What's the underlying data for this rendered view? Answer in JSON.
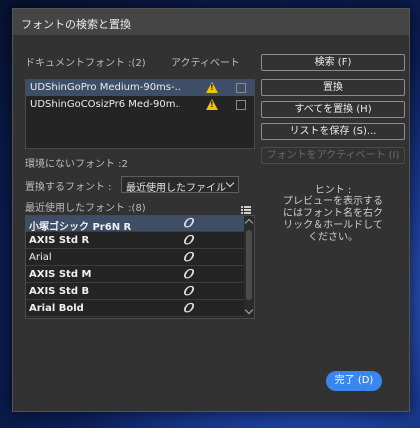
{
  "dialog": {
    "title": "フォントの検索と置換",
    "document_fonts_label": "ドキュメントフォント :(2)",
    "active_label": "アクティベート",
    "document_fonts": [
      {
        "name": "UDShinGoPro Medium-90ms-...",
        "missing": true,
        "checked": false
      },
      {
        "name": "UDShinGoCOsizPr6 Med-90m...",
        "missing": true,
        "checked": false
      }
    ],
    "missing_fonts_label": "環境にないフォント :2",
    "replace_with_label": "置換するフォント :",
    "replace_with_value": "最近使用したファイル",
    "recent_fonts_label": "最近使用したフォント :(8)",
    "recent_fonts": [
      {
        "name": "小塚ゴシック Pr6N R",
        "type_icon": "𝑂",
        "selected": true
      },
      {
        "name": "AXIS Std R",
        "type_icon": "𝑂",
        "selected": false
      },
      {
        "name": "Arial",
        "type_icon": "𝑂",
        "selected": false,
        "light": true
      },
      {
        "name": "AXIS Std M",
        "type_icon": "𝑂",
        "selected": false
      },
      {
        "name": "AXIS Std B",
        "type_icon": "𝑂",
        "selected": false
      },
      {
        "name": "Arial Bold",
        "type_icon": "𝑂",
        "selected": false
      }
    ],
    "buttons": {
      "find": "検索 (F)",
      "replace": "置換",
      "replace_all": "すべてを置換 (H)",
      "save_list": "リストを保存 (S)...",
      "activate_font": "フォントをアクティベート (I)",
      "done": "完了 (D)"
    },
    "hint_title": "ヒント :",
    "hint_text": "プレビューを表示するにはフォント名を右クリック＆ホールドしてください。"
  },
  "colors": {
    "accent": "#3a86ef",
    "warning": "#f2c400",
    "selected_row": "#3d4e66"
  }
}
